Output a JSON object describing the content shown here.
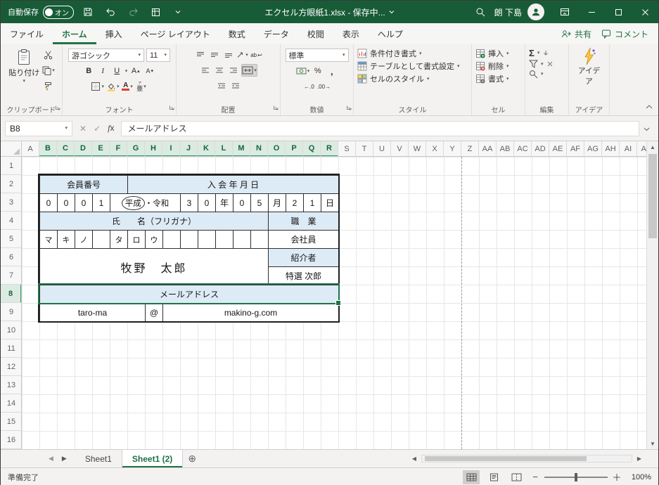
{
  "titlebar": {
    "autosave_label": "自動保存",
    "autosave_state": "オン",
    "title": "エクセル方眼紙1.xlsx - 保存中...",
    "user_name": "朗 下島"
  },
  "menubar": {
    "tabs": [
      "ファイル",
      "ホーム",
      "挿入",
      "ページ レイアウト",
      "数式",
      "データ",
      "校閲",
      "表示",
      "ヘルプ"
    ],
    "share": "共有",
    "comments": "コメント"
  },
  "ribbon": {
    "clipboard": {
      "label": "クリップボード",
      "paste": "貼り付け"
    },
    "font": {
      "label": "フォント",
      "name": "游ゴシック",
      "size": "11"
    },
    "alignment": {
      "label": "配置",
      "wrap": "ab"
    },
    "number": {
      "label": "数値",
      "format": "標準",
      "percent": "%",
      "comma": ",",
      "dec_inc": "←.0",
      "dec_dec": ".00→"
    },
    "styles": {
      "label": "スタイル",
      "conditional": "条件付き書式",
      "table": "テーブルとして書式設定",
      "cell": "セルのスタイル"
    },
    "cells": {
      "label": "セル",
      "insert": "挿入",
      "remove": "削除",
      "format": "書式"
    },
    "editing": {
      "label": "編集",
      "autosum": "Σ"
    },
    "ideas": {
      "label": "アイデア",
      "button": "アイデア"
    }
  },
  "formula_bar": {
    "name_box": "B8",
    "content": "メールアドレス"
  },
  "grid": {
    "columns": [
      "A",
      "B",
      "C",
      "D",
      "E",
      "F",
      "G",
      "H",
      "I",
      "J",
      "K",
      "L",
      "M",
      "N",
      "O",
      "P",
      "Q",
      "R",
      "S",
      "T",
      "U",
      "V",
      "W",
      "X",
      "Y",
      "Z",
      "AA",
      "AB",
      "AC",
      "AD",
      "AE",
      "AF",
      "AG",
      "AH",
      "AI",
      "AJ"
    ],
    "rows": [
      1,
      2,
      3,
      4,
      5,
      6,
      7,
      8,
      9,
      10,
      11,
      12,
      13,
      14,
      15,
      16
    ],
    "selected_columns": [
      "B",
      "C",
      "D",
      "E",
      "F",
      "G",
      "H",
      "I",
      "J",
      "K",
      "L",
      "M",
      "N",
      "O",
      "P",
      "Q",
      "R"
    ],
    "selected_row": 8
  },
  "form": {
    "era": {
      "circled": "平成",
      "separator": "・",
      "alternative": "令和"
    },
    "cells": [
      {
        "n": "member-number-header",
        "r": 2,
        "c": 1,
        "cs": 5,
        "t": "会員番号",
        "bg": 1
      },
      {
        "n": "join-date-header",
        "r": 2,
        "c": 6,
        "cs": 12,
        "t": "入 会 年 月 日",
        "bg": 1
      },
      {
        "n": "member-number-digit-1",
        "r": 3,
        "c": 1,
        "cs": 1,
        "t": "0"
      },
      {
        "n": "member-number-digit-2",
        "r": 3,
        "c": 2,
        "cs": 1,
        "t": "0"
      },
      {
        "n": "member-number-digit-3",
        "r": 3,
        "c": 3,
        "cs": 1,
        "t": "0"
      },
      {
        "n": "member-number-digit-4",
        "r": 3,
        "c": 4,
        "cs": 1,
        "t": "1"
      },
      {
        "n": "era-cell",
        "r": 3,
        "c": 5,
        "cs": 4,
        "era": 1
      },
      {
        "n": "join-year-digit-1",
        "r": 3,
        "c": 9,
        "cs": 1,
        "t": "3"
      },
      {
        "n": "join-year-digit-2",
        "r": 3,
        "c": 10,
        "cs": 1,
        "t": "0"
      },
      {
        "n": "year-label",
        "r": 3,
        "c": 11,
        "cs": 1,
        "t": "年"
      },
      {
        "n": "join-month-digit-1",
        "r": 3,
        "c": 12,
        "cs": 1,
        "t": "0"
      },
      {
        "n": "join-month-digit-2",
        "r": 3,
        "c": 13,
        "cs": 1,
        "t": "5"
      },
      {
        "n": "month-label",
        "r": 3,
        "c": 14,
        "cs": 1,
        "t": "月"
      },
      {
        "n": "join-day-digit-1",
        "r": 3,
        "c": 15,
        "cs": 1,
        "t": "2"
      },
      {
        "n": "join-day-digit-2",
        "r": 3,
        "c": 16,
        "cs": 1,
        "t": "1"
      },
      {
        "n": "day-label",
        "r": 3,
        "c": 17,
        "cs": 1,
        "t": "日"
      },
      {
        "n": "name-header",
        "r": 4,
        "c": 1,
        "cs": 13,
        "t": "氏　　名（フリガナ）",
        "bg": 1
      },
      {
        "n": "occupation-header",
        "r": 4,
        "c": 14,
        "cs": 4,
        "t": "職　業",
        "bg": 1
      },
      {
        "n": "furigana-1",
        "r": 5,
        "c": 1,
        "cs": 1,
        "t": "マ",
        "k": 1
      },
      {
        "n": "furigana-2",
        "r": 5,
        "c": 2,
        "cs": 1,
        "t": "キ",
        "k": 1
      },
      {
        "n": "furigana-3",
        "r": 5,
        "c": 3,
        "cs": 1,
        "t": "ノ",
        "k": 1
      },
      {
        "n": "furigana-4",
        "r": 5,
        "c": 4,
        "cs": 1,
        "t": "",
        "k": 1
      },
      {
        "n": "furigana-5",
        "r": 5,
        "c": 5,
        "cs": 1,
        "t": "タ",
        "k": 1
      },
      {
        "n": "furigana-6",
        "r": 5,
        "c": 6,
        "cs": 1,
        "t": "ロ",
        "k": 1
      },
      {
        "n": "furigana-7",
        "r": 5,
        "c": 7,
        "cs": 1,
        "t": "ウ",
        "k": 1
      },
      {
        "n": "furigana-8",
        "r": 5,
        "c": 8,
        "cs": 1,
        "t": "",
        "k": 1
      },
      {
        "n": "furigana-9",
        "r": 5,
        "c": 9,
        "cs": 1,
        "t": "",
        "k": 1
      },
      {
        "n": "furigana-10",
        "r": 5,
        "c": 10,
        "cs": 1,
        "t": "",
        "k": 1
      },
      {
        "n": "furigana-11",
        "r": 5,
        "c": 11,
        "cs": 1,
        "t": "",
        "k": 1
      },
      {
        "n": "furigana-12",
        "r": 5,
        "c": 12,
        "cs": 1,
        "t": "",
        "k": 1
      },
      {
        "n": "furigana-13",
        "r": 5,
        "c": 13,
        "cs": 1,
        "t": "",
        "k": 1
      },
      {
        "n": "occupation-value",
        "r": 5,
        "c": 14,
        "cs": 4,
        "t": "会社員"
      },
      {
        "n": "member-name",
        "r": 6,
        "c": 1,
        "cs": 13,
        "rs": 2,
        "t": "牧野　太郎",
        "big": 1
      },
      {
        "n": "introducer-header",
        "r": 6,
        "c": 14,
        "cs": 4,
        "t": "紹介者",
        "bg": 1
      },
      {
        "n": "introducer-value",
        "r": 7,
        "c": 14,
        "cs": 4,
        "t": "特選 次郎"
      },
      {
        "n": "email-header",
        "r": 8,
        "c": 1,
        "cs": 17,
        "t": "メールアドレス",
        "bg": 1,
        "sel": 1
      },
      {
        "n": "email-local",
        "r": 9,
        "c": 1,
        "cs": 6,
        "t": "taro-ma"
      },
      {
        "n": "email-at",
        "r": 9,
        "c": 7,
        "cs": 1,
        "t": "@"
      },
      {
        "n": "email-domain",
        "r": 9,
        "c": 8,
        "cs": 10,
        "t": "makino-g.com"
      }
    ]
  },
  "sheet_tabs": {
    "tabs": [
      {
        "label": "Sheet1",
        "active": false
      },
      {
        "label": "Sheet1 (2)",
        "active": true
      }
    ]
  },
  "status_bar": {
    "ready": "準備完了",
    "zoom": "100%"
  }
}
